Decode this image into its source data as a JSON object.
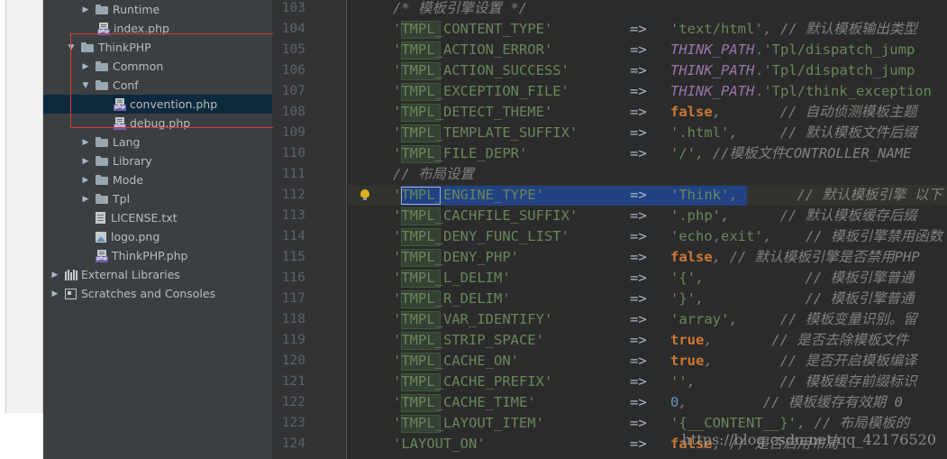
{
  "project_tree": {
    "items": [
      {
        "label": "Runtime",
        "type": "folder",
        "arrow": "▶"
      },
      {
        "label": "index.php",
        "type": "php",
        "arrow": ""
      },
      {
        "label": "ThinkPHP",
        "type": "folder",
        "arrow": "▼"
      },
      {
        "label": "Common",
        "type": "folder",
        "arrow": "▶"
      },
      {
        "label": "Conf",
        "type": "folder",
        "arrow": "▼"
      },
      {
        "label": "convention.php",
        "type": "php",
        "arrow": "",
        "selected": true
      },
      {
        "label": "debug.php",
        "type": "php",
        "arrow": ""
      },
      {
        "label": "Lang",
        "type": "folder",
        "arrow": "▶"
      },
      {
        "label": "Library",
        "type": "folder",
        "arrow": "▶"
      },
      {
        "label": "Mode",
        "type": "folder",
        "arrow": "▶"
      },
      {
        "label": "Tpl",
        "type": "folder",
        "arrow": "▶"
      },
      {
        "label": "LICENSE.txt",
        "type": "txt",
        "arrow": ""
      },
      {
        "label": "logo.png",
        "type": "img",
        "arrow": ""
      },
      {
        "label": "ThinkPHP.php",
        "type": "php",
        "arrow": ""
      },
      {
        "label": "External Libraries",
        "type": "lib",
        "arrow": "▶"
      },
      {
        "label": "Scratches and Consoles",
        "type": "scratch",
        "arrow": "▶"
      }
    ]
  },
  "editor": {
    "line_numbers": [
      "103",
      "104",
      "105",
      "106",
      "107",
      "108",
      "109",
      "110",
      "111",
      "112",
      "113",
      "114",
      "115",
      "116",
      "117",
      "118",
      "119",
      "120",
      "121",
      "122",
      "123",
      "124"
    ],
    "lines": [
      {
        "text": "/* 模板引擎设置 */"
      },
      {
        "key": "'TMPL_CONTENT_TYPE'",
        "value": "'text/html'",
        "comment": ", // 默认模板输出类型"
      },
      {
        "key": "'TMPL_ACTION_ERROR'",
        "const": "THINK_PATH",
        "value": ".'Tpl/dispatch_jump"
      },
      {
        "key": "'TMPL_ACTION_SUCCESS'",
        "const": "THINK_PATH",
        "value": ".'Tpl/dispatch_jump"
      },
      {
        "key": "'TMPL_EXCEPTION_FILE'",
        "const": "THINK_PATH",
        "value": ".'Tpl/think_exception"
      },
      {
        "key": "'TMPL_DETECT_THEME'",
        "value": "false",
        "comment": ",       // 自动侦测模板主题"
      },
      {
        "key": "'TMPL_TEMPLATE_SUFFIX'",
        "value": "'.html'",
        "comment": ",     // 默认模板文件后缀"
      },
      {
        "key": "'TMPL_FILE_DEPR'",
        "value": "'/'",
        "comment": ", //模板文件CONTROLLER_NAME"
      },
      {
        "text": "// 布局设置"
      },
      {
        "key": "'TMPL_ENGINE_TYPE'",
        "value": "'Think'",
        "comment": ",       // 默认模板引擎 以下"
      },
      {
        "key": "'TMPL_CACHFILE_SUFFIX'",
        "value": "'.php'",
        "comment": ",      // 默认模板缓存后缀"
      },
      {
        "key": "'TMPL_DENY_FUNC_LIST'",
        "value": "'echo,exit'",
        "comment": ",    // 模板引擎禁用函数"
      },
      {
        "key": "'TMPL_DENY_PHP'",
        "value": "false",
        "comment": ", // 默认模板引擎是否禁用PHP"
      },
      {
        "key": "'TMPL_L_DELIM'",
        "value": "'{'",
        "comment": ",            // 模板引擎普通"
      },
      {
        "key": "'TMPL_R_DELIM'",
        "value": "'}'",
        "comment": ",            // 模板引擎普通"
      },
      {
        "key": "'TMPL_VAR_IDENTIFY'",
        "value": "'array'",
        "comment": ",     // 模板变量识别。留"
      },
      {
        "key": "'TMPL_STRIP_SPACE'",
        "value": "true",
        "comment": ",       // 是否去除模板文件"
      },
      {
        "key": "'TMPL_CACHE_ON'",
        "value": "true",
        "comment": ",        // 是否开启模板编译"
      },
      {
        "key": "'TMPL_CACHE_PREFIX'",
        "value": "''",
        "comment": ",          // 模板缓存前缀标识"
      },
      {
        "key": "'TMPL_CACHE_TIME'",
        "value": "0",
        "comment": ",         // 模板缓存有效期 0"
      },
      {
        "key": "'TMPL_LAYOUT_ITEM'",
        "value": "'{__CONTENT__}'",
        "comment": ", // 布局模板的"
      },
      {
        "key": "'LAYOUT_ON'",
        "value": "false",
        "comment": ", // 是否启用布局"
      }
    ],
    "arrow": "=>"
  },
  "watermark": "https://blog.csdn.net/qq_42176520",
  "colors": {
    "selection": "#214283",
    "string": "#6a8759",
    "keyword": "#cc7832",
    "constant": "#9876aa",
    "comment": "#808080",
    "annotation_box": "#d93a3a"
  }
}
